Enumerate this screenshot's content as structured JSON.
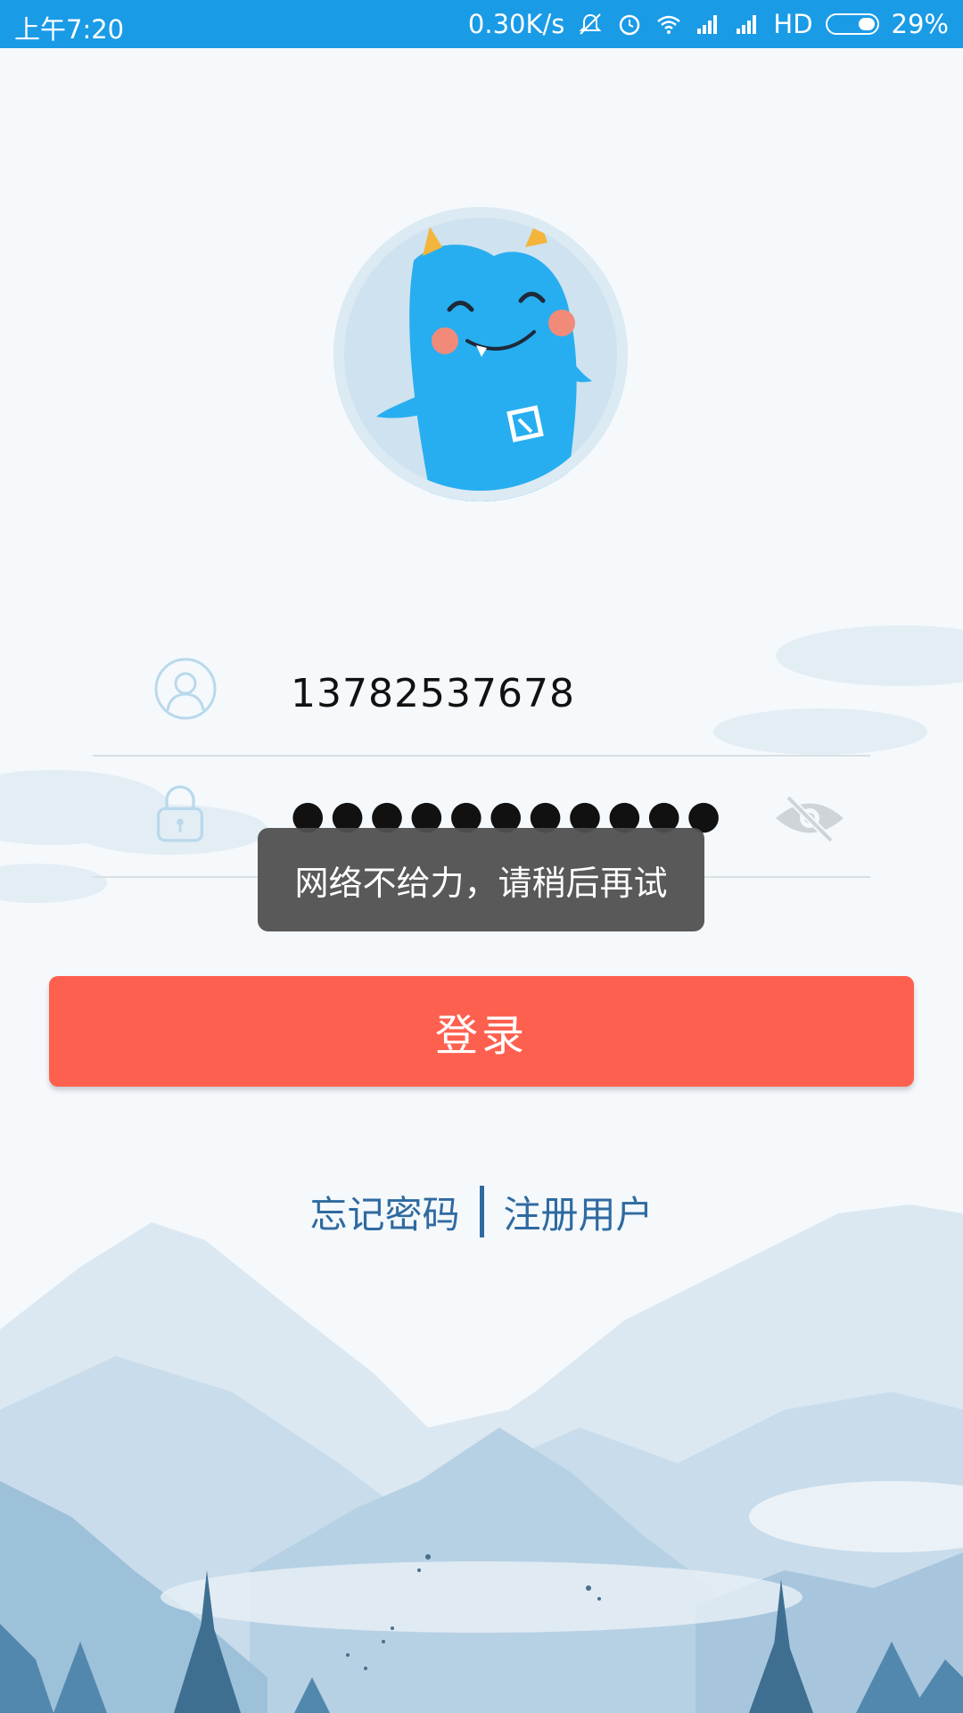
{
  "status_bar": {
    "time": "上午7:20",
    "speed": "0.30K/s",
    "network_label": "HD",
    "battery": "29%"
  },
  "login_form": {
    "phone_value": "13782537678",
    "password_masked": "●●●●●●●●●●●"
  },
  "toast": {
    "message": "网络不给力，请稍后再试"
  },
  "actions": {
    "login_label": "登录",
    "forgot_password_label": "忘记密码",
    "register_label": "注册用户"
  },
  "colors": {
    "status_bar": "#1a9be6",
    "login_button": "#fe604f",
    "link": "#2f6aa0"
  },
  "icons": {
    "user": "user-icon",
    "lock": "lock-icon",
    "eye": "eye-off-icon"
  }
}
